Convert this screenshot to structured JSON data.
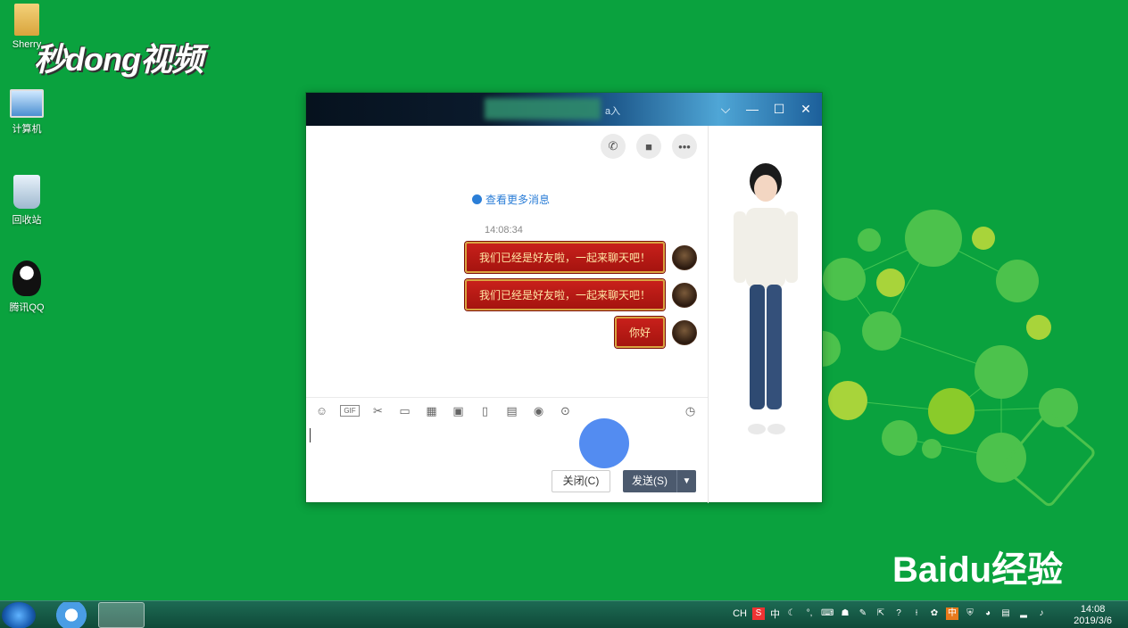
{
  "desktop": {
    "icons": [
      {
        "label": "Sherry"
      },
      {
        "label": "计算机"
      },
      {
        "label": "回收站"
      },
      {
        "label": "腾讯QQ"
      }
    ],
    "watermark_top": "秒dong视频",
    "watermark_bottom": "Baidu经验"
  },
  "chat": {
    "title_suffix": "a入",
    "more_messages": "查看更多消息",
    "timestamp": "14:08:34",
    "messages": [
      {
        "text": "我们已经是好友啦，一起来聊天吧！"
      },
      {
        "text": "我们已经是好友啦，一起来聊天吧！"
      },
      {
        "text": "你好"
      }
    ],
    "close_label": "关闭(C)",
    "send_label": "发送(S)",
    "toolbar_gif": "GIF"
  },
  "taskbar": {
    "clock_time": "14:08",
    "clock_date": "2019/3/6",
    "tray_lang": "CH",
    "tray_ime": "中",
    "tray_ime2": "中"
  },
  "colors": {
    "desktop_bg": "#0aa23e",
    "bubble": "#b8170f",
    "bubble_text": "#ffe7a6",
    "link": "#2b7ed7",
    "send_btn": "#4c5a6e"
  }
}
